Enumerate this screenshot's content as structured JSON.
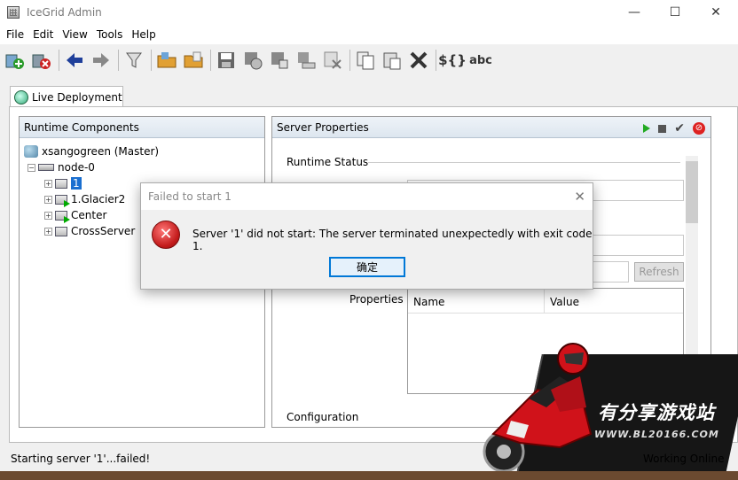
{
  "window": {
    "title": "IceGrid Admin",
    "minimize": "—",
    "maximize": "☐",
    "close": "✕"
  },
  "menu": [
    "File",
    "Edit",
    "View",
    "Tools",
    "Help"
  ],
  "toolbar": {
    "text_braces": "${}",
    "text_abc": "abc"
  },
  "tab": {
    "label": "Live Deployment"
  },
  "runtime_components": {
    "header": "Runtime Components",
    "master": "xsangogreen (Master)",
    "node": "node-0",
    "servers": [
      "1",
      "1.Glacier2",
      "Center",
      "CrossServer"
    ]
  },
  "server_properties": {
    "header": "Server Properties",
    "runtime_status": "Runtime Status",
    "refresh": "Refresh",
    "properties_label": "Properties",
    "columns": [
      "Name",
      "Value"
    ],
    "configuration": "Configuration"
  },
  "dialog": {
    "title": "Failed to start 1",
    "close": "✕",
    "message": "Server '1' did not start: The server terminated unexpectedly with exit code 1.",
    "ok": "确定"
  },
  "status": {
    "left": "Starting server '1'...failed!",
    "right": "Working Online"
  },
  "watermark": {
    "text": "有分享游戏站",
    "url": "WWW.BL20166.COM"
  },
  "colors": {
    "selection": "#1a6fd0",
    "running": "#22aa22",
    "error": "#c31b1b",
    "accent": "#0078d7"
  }
}
